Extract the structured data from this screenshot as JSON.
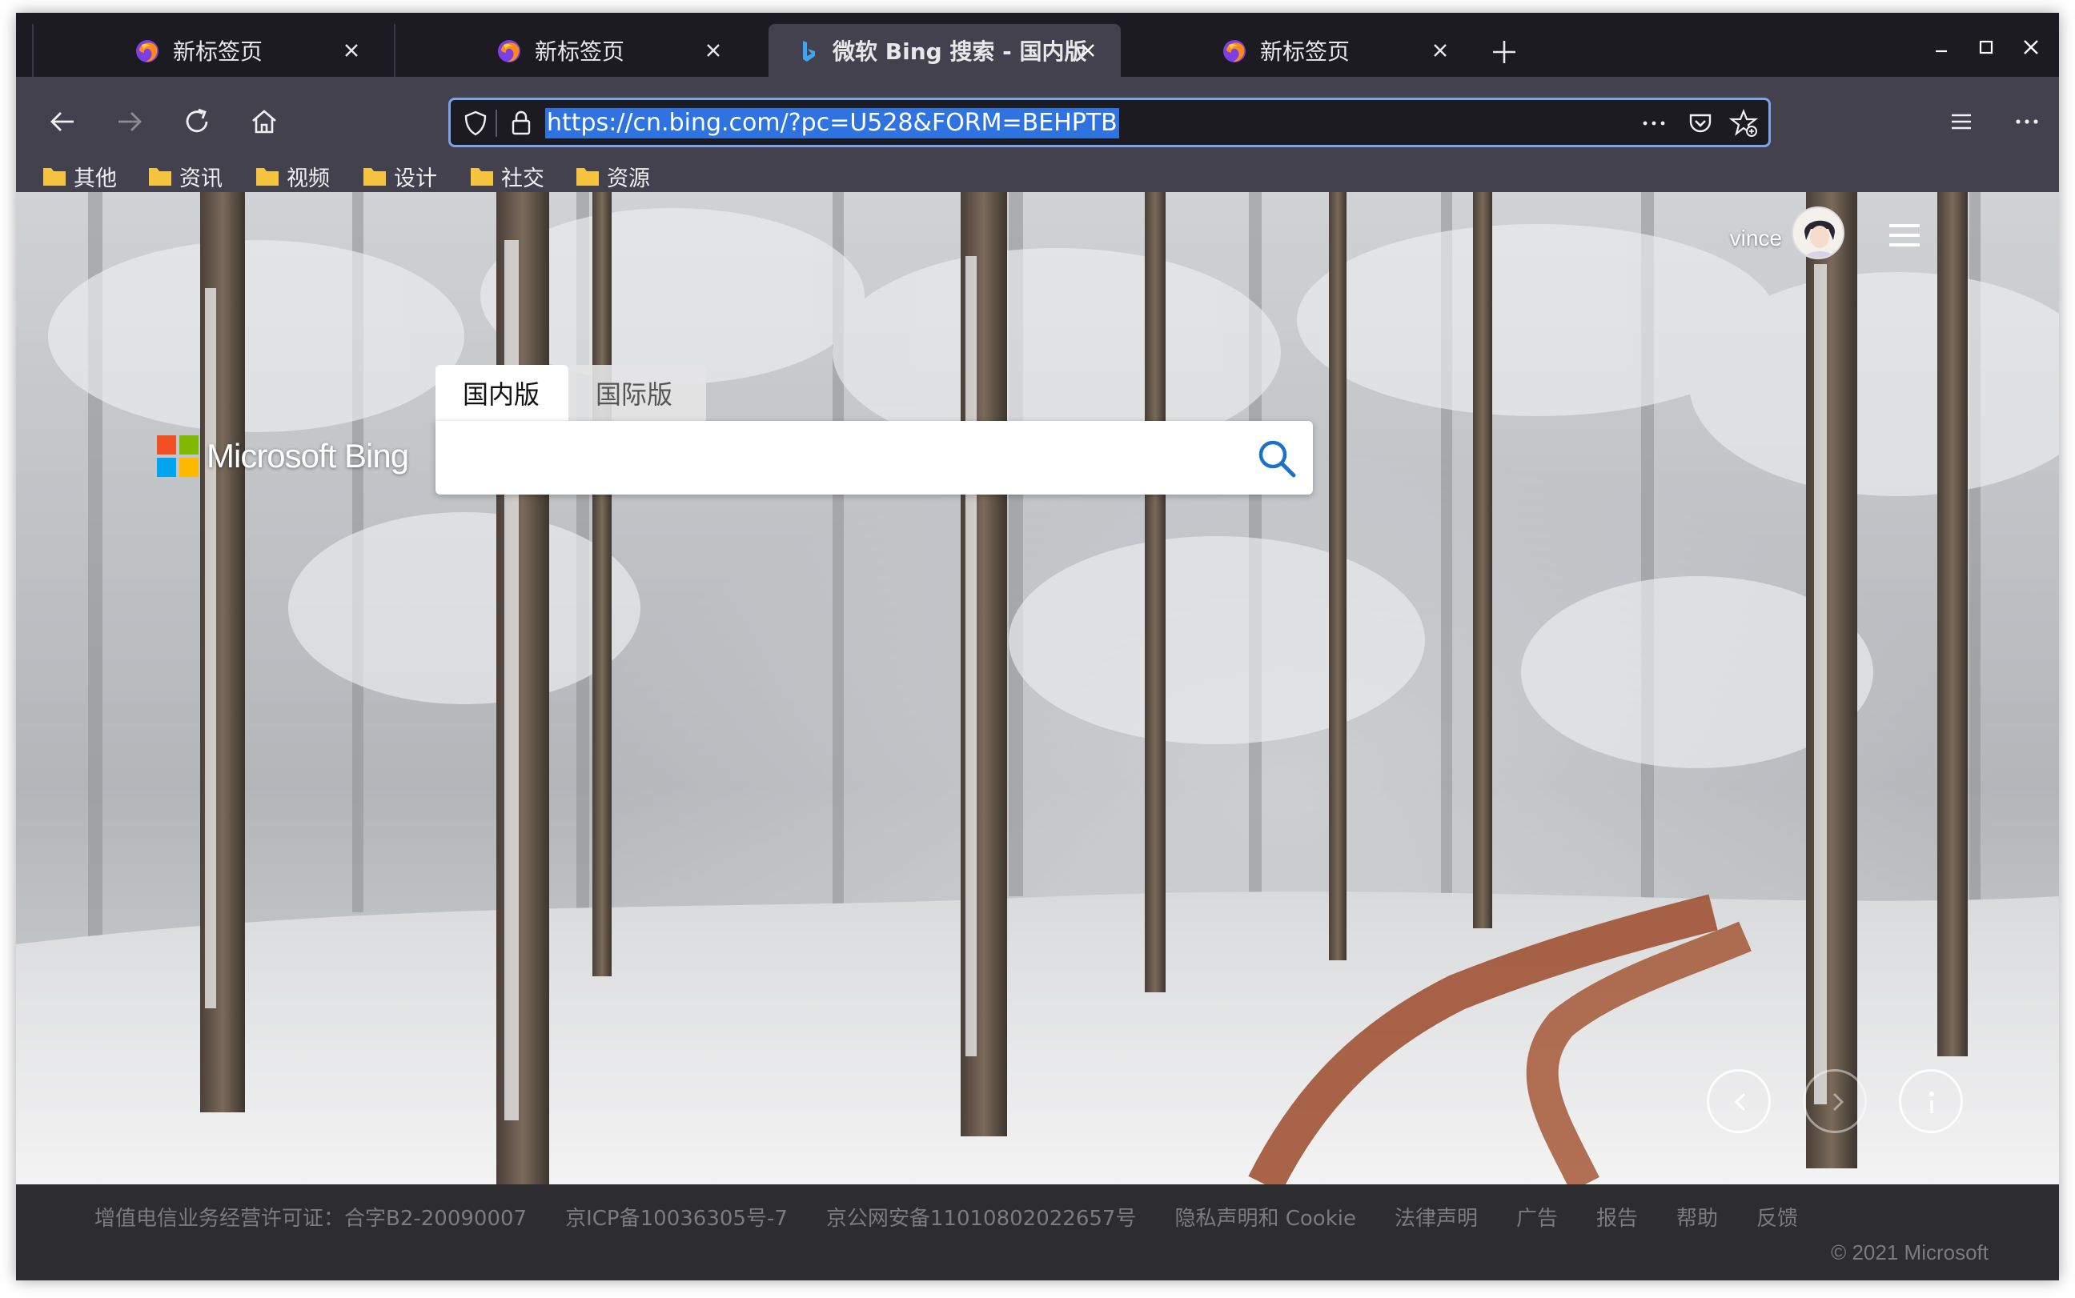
{
  "tabs": [
    {
      "label": "新标签页",
      "icon": "firefox-icon",
      "active": false
    },
    {
      "label": "新标签页",
      "icon": "firefox-icon",
      "active": false
    },
    {
      "label": "微软 Bing 搜索 - 国内版",
      "icon": "bing-icon",
      "active": true
    },
    {
      "label": "新标签页",
      "icon": "firefox-icon",
      "active": false
    }
  ],
  "address_bar": {
    "url": "https://cn.bing.com/?pc=U528&FORM=BEHPTB",
    "selected": true
  },
  "bookmarks": [
    "其他",
    "资讯",
    "视频",
    "设计",
    "社交",
    "资源"
  ],
  "page": {
    "user_name": "vince",
    "logo_text": "Microsoft Bing",
    "search_tabs": [
      "国内版",
      "国际版"
    ],
    "active_search_tab": "国内版",
    "search_value": ""
  },
  "footer": {
    "links": [
      "增值电信业务经营许可证：合字B2-20090007",
      "京ICP备10036305号-7",
      "京公网安备11010802022657号",
      "隐私声明和 Cookie",
      "法律声明",
      "广告",
      "报告",
      "帮助",
      "反馈"
    ],
    "copyright": "© 2021 Microsoft"
  },
  "colors": {
    "tab_strip": "#1c1b22",
    "toolbar": "#42414d",
    "url_highlight": "#2f73e0",
    "url_focus_border": "#7aa4e6",
    "footer_bg": "#2d2c2f",
    "ms_red": "#f25022",
    "ms_green": "#7fba00",
    "ms_blue": "#00a4ef",
    "ms_yellow": "#ffb900"
  }
}
